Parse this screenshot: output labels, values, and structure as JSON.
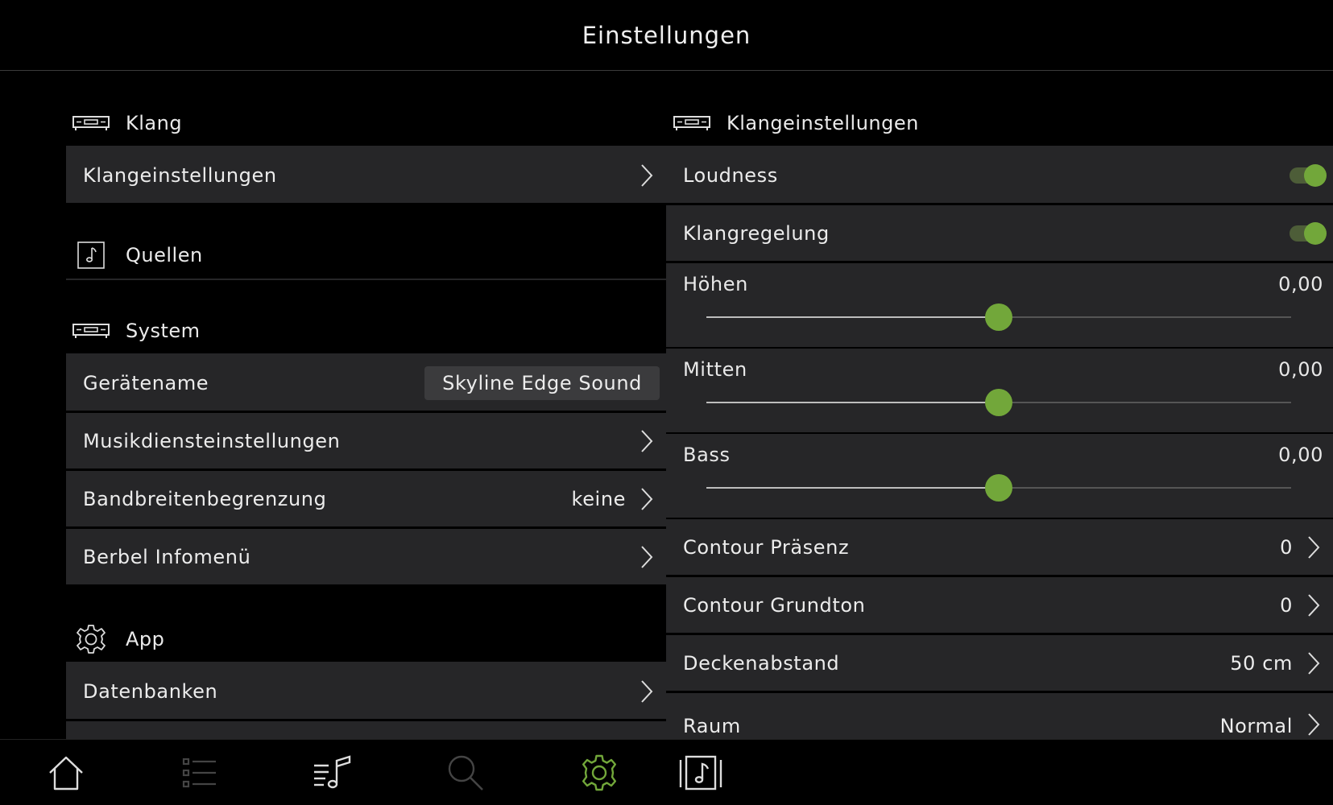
{
  "header": {
    "title": "Einstellungen"
  },
  "left": {
    "klang": {
      "heading": "Klang",
      "items": [
        {
          "label": "Klangeinstellungen"
        }
      ]
    },
    "quellen": {
      "heading": "Quellen"
    },
    "system": {
      "heading": "System",
      "geraetename_label": "Gerätename",
      "geraetename_value": "Skyline Edge Sound",
      "musik_label": "Musikdiensteinstellungen",
      "bandbreite_label": "Bandbreitenbegrenzung",
      "bandbreite_value": "keine",
      "berbel_label": "Berbel Infomenü"
    },
    "app": {
      "heading": "App",
      "datenbanken_label": "Datenbanken"
    }
  },
  "right": {
    "heading": "Klangeinstellungen",
    "loudness": {
      "label": "Loudness",
      "on": true
    },
    "klangregelung": {
      "label": "Klangregelung",
      "on": true
    },
    "sliders": [
      {
        "label": "Höhen",
        "value": "0,00",
        "position": 0.5
      },
      {
        "label": "Mitten",
        "value": "0,00",
        "position": 0.5
      },
      {
        "label": "Bass",
        "value": "0,00",
        "position": 0.5
      }
    ],
    "rows": [
      {
        "label": "Contour Präsenz",
        "value": "0"
      },
      {
        "label": "Contour Grundton",
        "value": "0"
      },
      {
        "label": "Deckenabstand",
        "value": "50 cm"
      },
      {
        "label": "Raum",
        "value": "Normal"
      }
    ]
  },
  "tabbar": {
    "items": [
      {
        "icon": "home-icon"
      },
      {
        "icon": "list-icon"
      },
      {
        "icon": "playlist-icon"
      },
      {
        "icon": "search-icon"
      },
      {
        "icon": "gear-icon",
        "active": true
      },
      {
        "icon": "now-playing-icon"
      }
    ]
  },
  "colors": {
    "accent": "#72a73a",
    "row_bg": "#262628",
    "background": "#000000"
  }
}
